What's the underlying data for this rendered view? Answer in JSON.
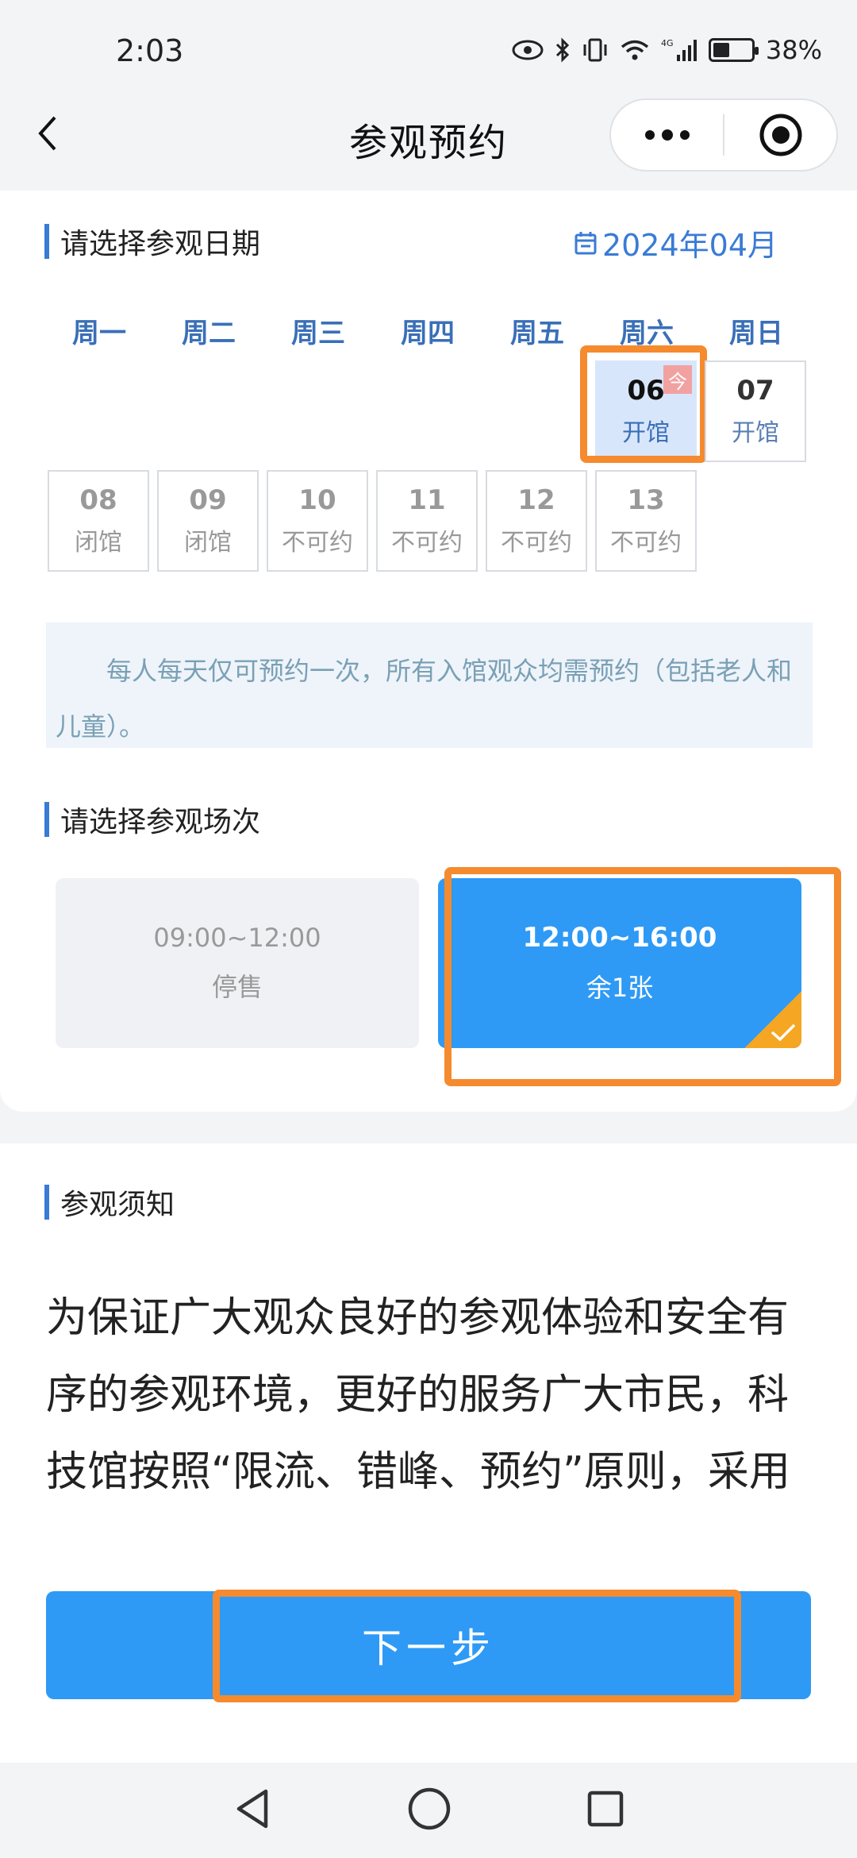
{
  "status_bar": {
    "time": "2:03",
    "battery_percent": "38%",
    "battery_level": 0.38,
    "network": "4G"
  },
  "nav": {
    "title": "参观预约"
  },
  "date_section": {
    "title": "请选择参观日期",
    "month": "2024年04月",
    "weekdays": [
      "周一",
      "周二",
      "周三",
      "周四",
      "周五",
      "周六",
      "周日"
    ],
    "today_tag": "今",
    "week1": [
      {
        "num": "06",
        "status": "开馆",
        "selected": true,
        "today": true
      },
      {
        "num": "07",
        "status": "开馆"
      }
    ],
    "week2": [
      {
        "num": "08",
        "status": "闭馆"
      },
      {
        "num": "09",
        "status": "闭馆"
      },
      {
        "num": "10",
        "status": "不可约"
      },
      {
        "num": "11",
        "status": "不可约"
      },
      {
        "num": "12",
        "status": "不可约"
      },
      {
        "num": "13",
        "status": "不可约"
      }
    ]
  },
  "notice": {
    "text": "每人每天仅可预约一次，所有入馆观众均需预约（包括老人和儿童）。"
  },
  "session_section": {
    "title": "请选择参观场次",
    "slots": [
      {
        "time": "09:00~12:00",
        "status": "停售",
        "selected": false
      },
      {
        "time": "12:00~16:00",
        "status": "余1张",
        "selected": true
      }
    ]
  },
  "notes_section": {
    "title": "参观须知",
    "text": "为保证广大观众良好的参观体验和安全有序的参观环境，更好的服务广大市民，科技馆按照“限流、错峰、预约”原则，采用散客线上和团队电话的预约方式。"
  },
  "actions": {
    "next_label": "下一步"
  },
  "colors": {
    "primary": "#2e9af5",
    "accent_title": "#3a7bd5",
    "highlight": "#f58a2e"
  }
}
